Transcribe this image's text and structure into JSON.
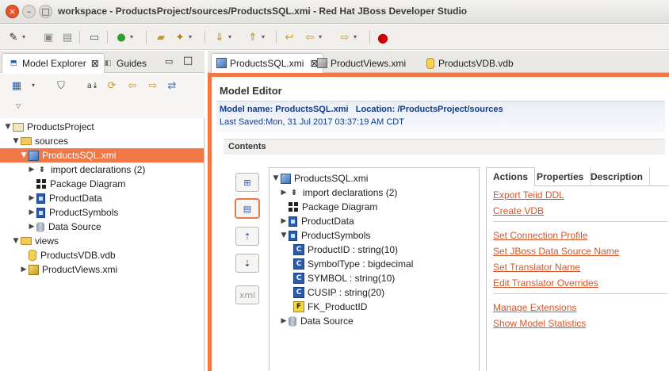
{
  "window": {
    "title": "workspace - ProductsProject/sources/ProductsSQL.xmi - Red Hat JBoss Developer Studio"
  },
  "left_panel": {
    "tabs": [
      {
        "label": "Model Explorer",
        "active": true
      },
      {
        "label": "Guides",
        "active": false
      }
    ],
    "tree": [
      {
        "label": "ProductsProject",
        "depth": 0,
        "expanded": true,
        "icon": "project-icon"
      },
      {
        "label": "sources",
        "depth": 1,
        "expanded": true,
        "icon": "folder-icon"
      },
      {
        "label": "ProductsSQL.xmi",
        "depth": 2,
        "expanded": true,
        "icon": "model-icon",
        "selected": true
      },
      {
        "label": "import declarations (2)",
        "depth": 3,
        "expanded": false,
        "icon": "import-icon"
      },
      {
        "label": "Package Diagram",
        "depth": 3,
        "icon": "diagram-icon"
      },
      {
        "label": "ProductData",
        "depth": 3,
        "expanded": false,
        "icon": "table-icon"
      },
      {
        "label": "ProductSymbols",
        "depth": 3,
        "expanded": false,
        "icon": "table-icon"
      },
      {
        "label": "Data Source",
        "depth": 3,
        "expanded": false,
        "icon": "datasource-icon"
      },
      {
        "label": "views",
        "depth": 1,
        "expanded": true,
        "icon": "folder-icon"
      },
      {
        "label": "ProductsVDB.vdb",
        "depth": 2,
        "icon": "vdb-icon"
      },
      {
        "label": "ProductViews.xmi",
        "depth": 2,
        "expanded": false,
        "icon": "view-model-icon"
      }
    ]
  },
  "editor": {
    "tabs": [
      {
        "label": "ProductsSQL.xmi",
        "active": true,
        "closable": true
      },
      {
        "label": "ProductViews.xmi",
        "active": false
      },
      {
        "label": "ProductsVDB.vdb",
        "active": false
      }
    ],
    "title": "Model Editor",
    "model_name_label": "Model name:",
    "model_name": "ProductsSQL.xmi",
    "location_label": "Location:",
    "location": "/ProductsProject/sources",
    "last_saved": "Last Saved:Mon, 31 Jul 2017 03:37:19 AM CDT",
    "contents_label": "Contents",
    "content_tree": [
      {
        "label": "ProductsSQL.xmi",
        "depth": 0,
        "expanded": true,
        "icon": "model-icon"
      },
      {
        "label": "import declarations (2)",
        "depth": 1,
        "expanded": false,
        "icon": "import-icon"
      },
      {
        "label": "Package Diagram",
        "depth": 1,
        "icon": "diagram-icon"
      },
      {
        "label": "ProductData",
        "depth": 1,
        "expanded": false,
        "icon": "table-icon"
      },
      {
        "label": "ProductSymbols",
        "depth": 1,
        "expanded": true,
        "icon": "table-icon"
      },
      {
        "label": "ProductID : string(10)",
        "depth": 2,
        "icon": "pk-column-icon"
      },
      {
        "label": "SymbolType : bigdecimal",
        "depth": 2,
        "icon": "column-icon"
      },
      {
        "label": "SYMBOL : string(10)",
        "depth": 2,
        "icon": "column-icon"
      },
      {
        "label": "CUSIP : string(20)",
        "depth": 2,
        "icon": "column-icon"
      },
      {
        "label": "FK_ProductID",
        "depth": 2,
        "icon": "fk-icon"
      },
      {
        "label": "Data Source",
        "depth": 1,
        "expanded": false,
        "icon": "datasource-icon"
      }
    ],
    "right_tabs": [
      {
        "label": "Actions",
        "active": true
      },
      {
        "label": "Properties",
        "active": false
      },
      {
        "label": "Description",
        "active": false
      }
    ],
    "actions": {
      "group1": [
        "Export Teiid DDL",
        "Create VDB"
      ],
      "group2": [
        "Set Connection Profile",
        "Set JBoss Data Source Name",
        "Set Translator Name",
        "Edit Translator Overrides"
      ],
      "group3": [
        "Manage Extensions",
        "Show Model Statistics"
      ]
    }
  },
  "colors": {
    "selection": "#f07746",
    "link": "#d4572a",
    "info_text": "#123c8a"
  }
}
